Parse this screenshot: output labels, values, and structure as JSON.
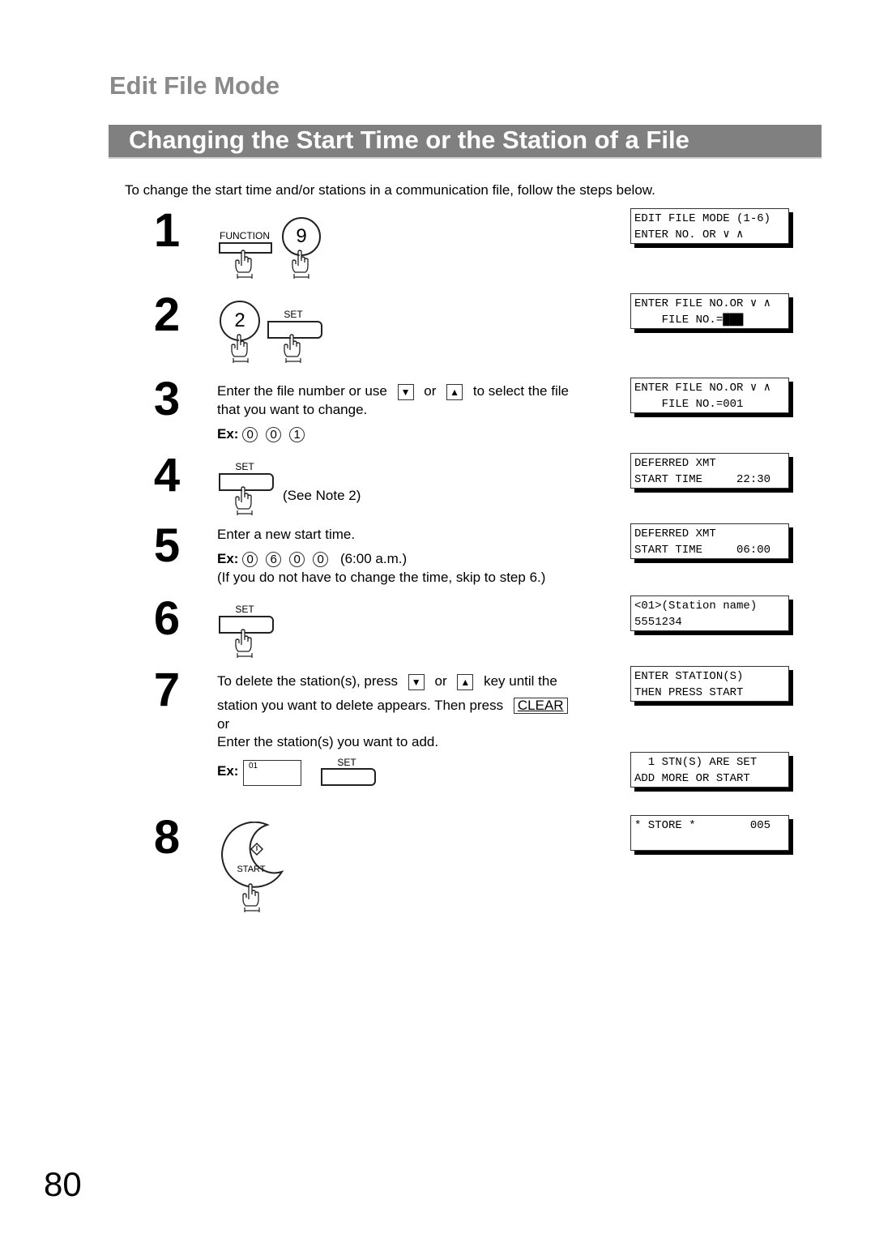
{
  "header": {
    "section_title": "Edit File Mode",
    "page_title": "Changing the Start Time or the Station of a File",
    "intro": "To change the start time and/or stations in a communication file, follow the steps below."
  },
  "steps": [
    {
      "number": "1",
      "keys": {
        "function_label": "FUNCTION",
        "digit": "9"
      }
    },
    {
      "number": "2",
      "keys": {
        "digit": "2",
        "set_label": "SET"
      }
    },
    {
      "number": "3",
      "text_a": "Enter the file number or use",
      "or": "or",
      "text_b": "to select the file",
      "text_c": "that you want to change.",
      "ex_label": "Ex:",
      "ex_digits": [
        "0",
        "0",
        "1"
      ],
      "down_icon": "▼",
      "up_icon": "▲"
    },
    {
      "number": "4",
      "set_label": "SET",
      "note": "(See Note 2)"
    },
    {
      "number": "5",
      "text_a": "Enter a new start time.",
      "ex_label": "Ex:",
      "ex_digits": [
        "0",
        "6",
        "0",
        "0"
      ],
      "ex_note": "(6:00 a.m.)",
      "text_b": "(If you do not have to change the time, skip to step 6.)"
    },
    {
      "number": "6",
      "set_label": "SET"
    },
    {
      "number": "7",
      "text_a": "To delete the station(s), press",
      "or": "or",
      "text_b": "key until the",
      "text_c": "station you want to delete appears.  Then press",
      "clear_label": "CLEAR",
      "text_or": "or",
      "text_d": "Enter the station(s) you want to add.",
      "ex_label": "Ex:",
      "ex_input": "01",
      "set_label": "SET",
      "down_icon": "▼",
      "up_icon": "▲"
    },
    {
      "number": "8",
      "start_label": "START"
    }
  ],
  "lcd_displays": [
    {
      "line1": "EDIT FILE MODE (1-6)",
      "line2": "ENTER NO. OR ∨ ∧"
    },
    {
      "line1": "ENTER FILE NO.OR ∨ ∧",
      "line2": "    FILE NO.=███"
    },
    {
      "line1": "ENTER FILE NO.OR ∨ ∧",
      "line2": "    FILE NO.=001"
    },
    {
      "line1": "DEFERRED XMT",
      "line2": "START TIME     22:30"
    },
    {
      "line1": "DEFERRED XMT",
      "line2": "START TIME     06:00"
    },
    {
      "line1": "<01>(Station name)",
      "line2": "5551234"
    },
    {
      "line1": "ENTER STATION(S)",
      "line2": "THEN PRESS START"
    },
    {
      "line1": "  1 STN(S) ARE SET",
      "line2": "ADD MORE OR START"
    },
    {
      "line1": "* STORE *        005",
      "line2": ""
    }
  ],
  "footer": {
    "page_number": "80"
  }
}
